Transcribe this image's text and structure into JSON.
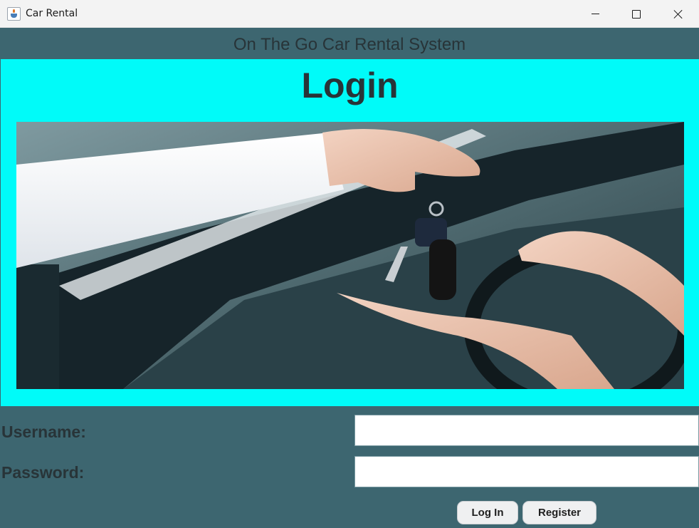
{
  "window": {
    "title": "Car Rental",
    "icon": "java-cup-icon",
    "controls": [
      "minimize-icon",
      "maximize-icon",
      "close-icon"
    ]
  },
  "header": {
    "system_title": "On The Go Car Rental System"
  },
  "panel": {
    "heading": "Login",
    "image": "car-key-handover-photo"
  },
  "form": {
    "username_label": "Username:",
    "username_value": "",
    "password_label": "Password:",
    "password_value": ""
  },
  "buttons": {
    "login_label": "Log In",
    "register_label": "Register"
  },
  "colors": {
    "window_bg": "#3d6670",
    "panel_bg": "#00fbf9",
    "text_dark": "#283438",
    "button_bg": "#eff0f1"
  }
}
